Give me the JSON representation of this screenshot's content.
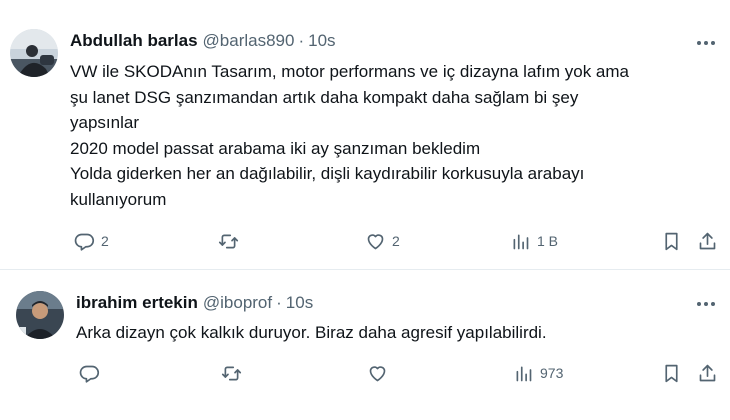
{
  "tweets": [
    {
      "display_name": "Abdullah barlas",
      "handle": "@barlas890",
      "separator": "·",
      "time": "10s",
      "lines": [
        "VW ile SKODAnın Tasarım, motor performans ve iç dizayna lafım yok ama",
        "şu lanet DSG şanzımandan artık daha kompakt daha sağlam bi şey",
        "yapsınlar",
        "2020 model passat arabama iki ay şanzıman bekledim",
        "Yolda giderken her an dağılabilir, dişli kaydırabilir korkusuyla arabayı",
        "kullanıyorum"
      ],
      "replies": "2",
      "retweets": "",
      "likes": "2",
      "views": "1 B"
    },
    {
      "display_name": "ibrahim ertekin",
      "handle": "@iboprof",
      "separator": "·",
      "time": "10s",
      "lines": [
        "Arka dizayn çok kalkık duruyor. Biraz daha agresif yapılabilirdi."
      ],
      "replies": "",
      "retweets": "",
      "likes": "",
      "views": "973"
    }
  ],
  "icons": {
    "reply": "reply-icon",
    "retweet": "retweet-icon",
    "like": "like-icon",
    "views": "views-icon",
    "bookmark": "bookmark-icon",
    "share": "share-icon",
    "more": "more-icon"
  },
  "colors": {
    "text": "#0f1419",
    "secondary": "#536471",
    "divider": "#e6ecf0"
  }
}
